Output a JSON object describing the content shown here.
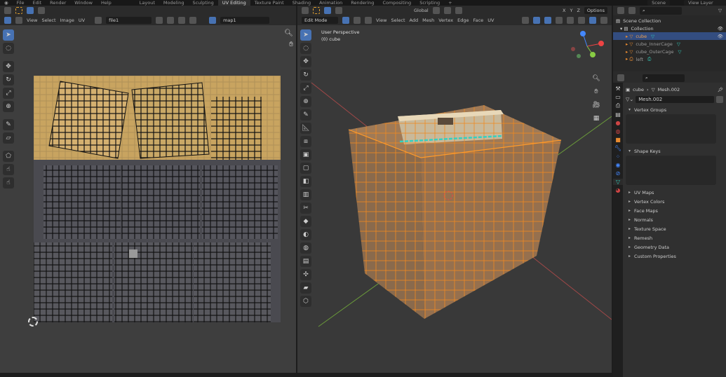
{
  "topbar": {
    "menus": [
      "File",
      "Edit",
      "Render",
      "Window",
      "Help"
    ],
    "workspaces": [
      "Layout",
      "Modeling",
      "Sculpting",
      "UV Editing",
      "Texture Paint",
      "Shading",
      "Animation",
      "Rendering",
      "Compositing",
      "Scripting"
    ],
    "active_workspace": "UV Editing",
    "scene": "Scene",
    "view_layer": "View Layer"
  },
  "uv_editor": {
    "menus": [
      "View",
      "Select",
      "Image",
      "UV"
    ],
    "image_name": "file1",
    "uv_map": "map1"
  },
  "viewport": {
    "mode": "Edit Mode",
    "menus": [
      "View",
      "Select",
      "Add",
      "Mesh",
      "Vertex",
      "Edge",
      "Face",
      "UV"
    ],
    "orientation": "Global",
    "options": "Options",
    "overlay_title": "User Perspective",
    "overlay_object": "(0) cube",
    "axes": [
      "X",
      "Y",
      "Z"
    ]
  },
  "outliner": {
    "root": "Scene Collection",
    "collection": "Collection",
    "items": [
      {
        "name": "cube",
        "selected": true
      },
      {
        "name": "cube_InnerCage"
      },
      {
        "name": "cube_OuterCage"
      },
      {
        "name": "left"
      }
    ]
  },
  "properties": {
    "object": "cube",
    "mesh": "Mesh.002",
    "mesh_field": "Mesh.002",
    "panels_open": [
      "Vertex Groups",
      "Shape Keys"
    ],
    "panels": [
      "UV Maps",
      "Vertex Colors",
      "Face Maps",
      "Normals",
      "Texture Space",
      "Remesh",
      "Geometry Data",
      "Custom Properties"
    ]
  },
  "colors": {
    "accent": "#4772b3",
    "selection": "#ff8c1a",
    "uv_accent": "#35d0c0"
  }
}
